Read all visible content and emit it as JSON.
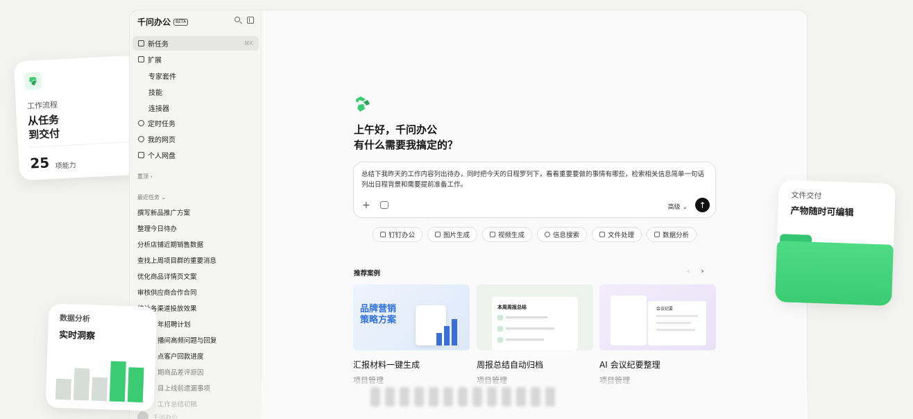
{
  "app": {
    "name": "千问办公",
    "badge": "BETA"
  },
  "sidebar": {
    "new_task": {
      "label": "新任务",
      "shortcut": "⌘K"
    },
    "extend": "扩展",
    "extend_items": [
      "专家套件",
      "技能",
      "连接器"
    ],
    "scheduled": "定时任务",
    "my_pages": "我的网页",
    "personal_drive": "个人网盘",
    "pinned_label": "置顶 ›",
    "recent_label": "最近任务 ⌄",
    "recent_tasks": [
      "撰写新品推广方案",
      "整理今日待办",
      "分析店铺近期销售数据",
      "查找上周项目群的重要消息",
      "优化商品详情页文案",
      "审核供应商合作合同",
      "统计各渠道投放效果",
      "年招聘计划",
      "播间高频问题与回复",
      "点客户回款进度",
      "期商品差评原因",
      "目上线前遗漏事项",
      "工作总结初稿"
    ],
    "user_name": "千问办公"
  },
  "main": {
    "greeting_line1": "上午好，千问办公",
    "greeting_line2": "有什么需要我搞定的？",
    "prompt_text": "总结下我昨天的工作内容列出待办，同时把今天的日程罗列下，看看重要要做的事情有哪些，检索相关信息简单一句话列出日程背景和需要提前准备工作。",
    "advanced_label": "高级 ⌄",
    "chips": [
      "钉钉办公",
      "图片生成",
      "视频生成",
      "信息搜索",
      "文件处理",
      "数据分析"
    ],
    "recommended_title": "推荐案例",
    "cases": [
      {
        "title": "汇报材料一键生成",
        "category": "项目管理",
        "image_text": "品牌营销\n策略方案"
      },
      {
        "title": "周报总结自动归档",
        "category": "项目管理",
        "image_text": "本周周报总结"
      },
      {
        "title": "AI 会议纪要整理",
        "category": "项目管理",
        "image_text": "会议纪要"
      }
    ]
  },
  "floating": {
    "workflow": {
      "label": "工作流程",
      "title_line1": "从任务",
      "title_line2": "到交付",
      "count": "25",
      "count_unit": "项能力"
    },
    "analytics": {
      "label": "数据分析",
      "title": "实时洞察"
    },
    "delivery": {
      "label": "文件交付",
      "title": "产物随时可编辑"
    }
  },
  "colors": {
    "accent": "#3bcc73",
    "send": "#111111"
  }
}
